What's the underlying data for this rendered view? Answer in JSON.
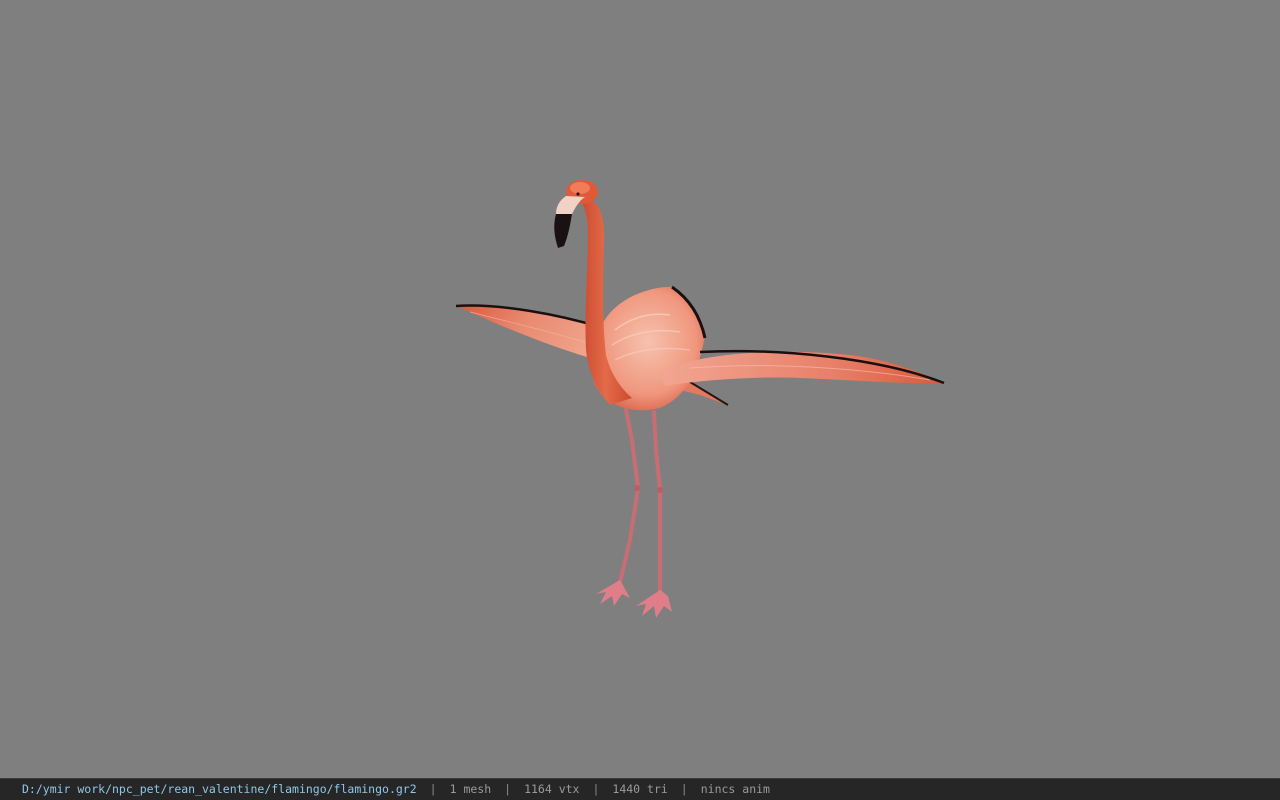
{
  "viewport": {
    "background_color": "#7f7f7f",
    "model": "flamingo"
  },
  "status_bar": {
    "file_path": "D:/ymir work/npc_pet/rean_valentine/flamingo/flamingo.gr2",
    "separator": "|",
    "mesh_count": "1 mesh",
    "vertex_count": "1164 vtx",
    "triangle_count": "1440 tri",
    "anim_status": "nincs anim",
    "path_color": "#8fc7e6",
    "text_color": "#9a9a9a"
  }
}
